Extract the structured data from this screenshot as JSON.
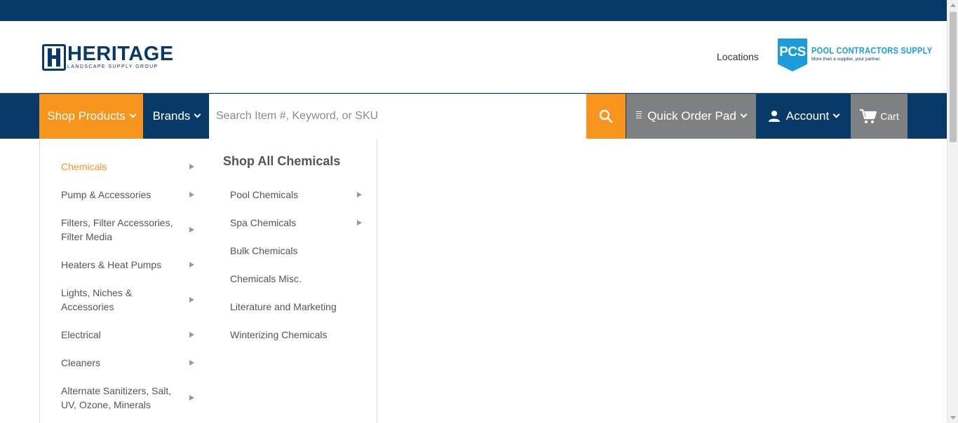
{
  "header": {
    "logo": {
      "name": "HERITAGE",
      "subtitle": "LANDSCAPE SUPPLY GROUP"
    },
    "locations_label": "Locations",
    "partner_logo": {
      "badge": "PCS",
      "name": "POOL CONTRACTORS SUPPLY",
      "tagline": "More than a supplier, your partner."
    }
  },
  "nav": {
    "shop_products_label": "Shop Products",
    "brands_label": "Brands",
    "search_placeholder": "Search Item #, Keyword, or SKU",
    "search_value": "",
    "quick_order_label": "Quick Order Pad",
    "account_label": "Account",
    "cart_label": "Cart"
  },
  "menu": {
    "categories": [
      {
        "label": "Chemicals",
        "active": true,
        "has_children": true
      },
      {
        "label": "Pump & Accessories",
        "active": false,
        "has_children": true
      },
      {
        "label": "Filters, Filter Accessories, Filter Media",
        "active": false,
        "has_children": true
      },
      {
        "label": "Heaters & Heat Pumps",
        "active": false,
        "has_children": true
      },
      {
        "label": "Lights, Niches & Accessories",
        "active": false,
        "has_children": true
      },
      {
        "label": "Electrical",
        "active": false,
        "has_children": true
      },
      {
        "label": "Cleaners",
        "active": false,
        "has_children": true
      },
      {
        "label": "Alternate Sanitizers, Salt, UV, Ozone, Minerals",
        "active": false,
        "has_children": true
      }
    ],
    "submenu": {
      "title": "Shop All Chemicals",
      "items": [
        {
          "label": "Pool Chemicals",
          "has_children": true
        },
        {
          "label": "Spa Chemicals",
          "has_children": true
        },
        {
          "label": "Bulk Chemicals",
          "has_children": false
        },
        {
          "label": "Chemicals Misc.",
          "has_children": false
        },
        {
          "label": "Literature and Marketing",
          "has_children": false
        },
        {
          "label": "Winterizing Chemicals",
          "has_children": false
        }
      ]
    }
  },
  "colors": {
    "brand_navy": "#083a68",
    "accent_orange": "#f7941d",
    "nav_gray": "#7f8082",
    "pcs_blue": "#1b9bd7"
  }
}
